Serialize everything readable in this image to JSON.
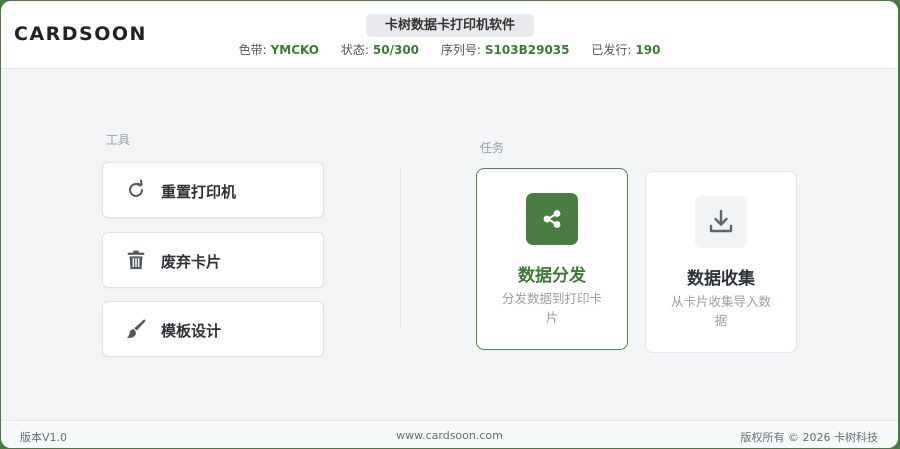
{
  "header": {
    "logo": "CARDSOON",
    "app_title": "卡树数据卡打印机软件",
    "status": [
      {
        "label": "色带:",
        "value": "YMCKO"
      },
      {
        "label": "状态:",
        "value": "50/300"
      },
      {
        "label": "序列号:",
        "value": "S103B29035"
      },
      {
        "label": "已发行:",
        "value": "190"
      }
    ]
  },
  "tools": {
    "heading": "工具",
    "items": [
      {
        "label": "重置打印机",
        "icon": "refresh-icon"
      },
      {
        "label": "废弃卡片",
        "icon": "trash-icon"
      },
      {
        "label": "模板设计",
        "icon": "brush-icon"
      }
    ]
  },
  "tasks": {
    "heading": "任务",
    "items": [
      {
        "title": "数据分发",
        "desc": "分发数据到打印卡片",
        "icon": "share-icon",
        "state": "selected"
      },
      {
        "title": "数据收集",
        "desc": "从卡片收集导入数据",
        "icon": "download-icon",
        "state": "normal"
      }
    ]
  },
  "footer": {
    "version": "版本V1.0",
    "website": "www.cardsoon.com",
    "copyright": "版权所有 © 2026 卡树科技"
  },
  "colors": {
    "accent": "#3e7a36",
    "accent_tile": "#4a7d42",
    "background": "#f3f4f6"
  }
}
